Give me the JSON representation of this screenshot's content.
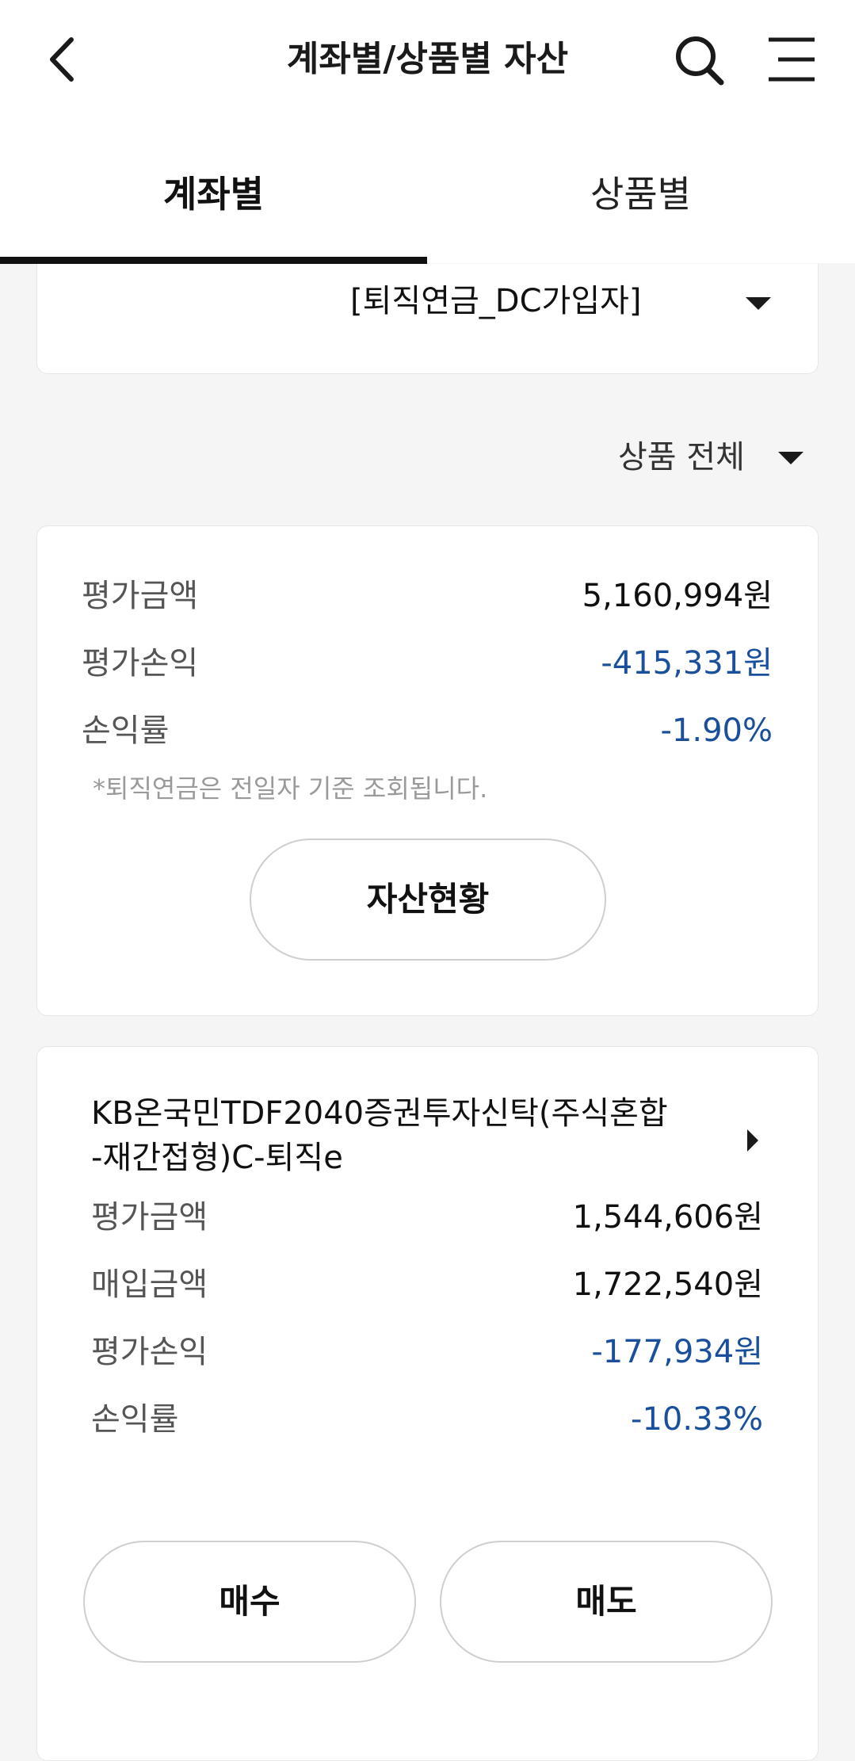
{
  "header": {
    "title": "계좌별/상품별 자산",
    "back_icon": "chevron-left-icon",
    "search_icon": "search-icon",
    "menu_icon": "hamburger-menu-icon"
  },
  "tabs": [
    {
      "label": "계좌별",
      "active": true
    },
    {
      "label": "상품별",
      "active": false
    }
  ],
  "account": {
    "selected": "[퇴직연금_DC가입자]"
  },
  "filter": {
    "selected": "상품 전체"
  },
  "summary": {
    "rows": [
      {
        "label": "평가금액",
        "value": "5,160,994원"
      },
      {
        "label": "평가손익",
        "value": "-415,331원"
      },
      {
        "label": "손익률",
        "value": "-1.90%"
      }
    ],
    "note": "*퇴직연금은 전일자 기준 조회됩니다.",
    "assets_button": "자산현황"
  },
  "product": {
    "name_line1": "KB온국민TDF2040증권투자신탁(주식혼합",
    "name_line2": "-재간접형)C-퇴직e",
    "rows": [
      {
        "label": "평가금액",
        "value": "1,544,606원"
      },
      {
        "label": "매입금액",
        "value": "1,722,540원"
      },
      {
        "label": "평가손익",
        "value": "-177,934원"
      },
      {
        "label": "손익률",
        "value": "-10.33%"
      }
    ],
    "buy_button": "매수",
    "sell_button": "매도"
  },
  "colors": {
    "negative": "#1a4f9c",
    "accent_underline": "#111111",
    "background": "#f5f5f5"
  }
}
